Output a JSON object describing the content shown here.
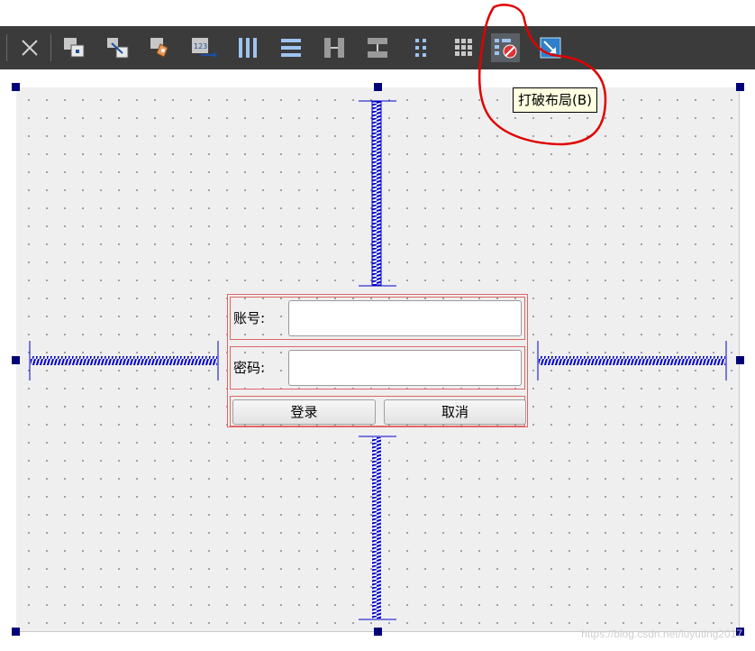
{
  "toolbar": {
    "buttons": [
      {
        "name": "close-icon"
      },
      {
        "name": "edit-widgets-icon"
      },
      {
        "name": "edit-signals-slots-icon"
      },
      {
        "name": "edit-buddies-icon"
      },
      {
        "name": "edit-tab-order-icon"
      },
      {
        "name": "layout-horizontal-icon"
      },
      {
        "name": "layout-vertical-icon"
      },
      {
        "name": "layout-horizontal-splitter-icon"
      },
      {
        "name": "layout-vertical-splitter-icon"
      },
      {
        "name": "layout-form-icon"
      },
      {
        "name": "layout-grid-icon"
      },
      {
        "name": "break-layout-icon"
      },
      {
        "name": "adjust-size-icon"
      }
    ],
    "tooltip": "打破布局(B)"
  },
  "form": {
    "account_label": "账号:",
    "password_label": "密码:",
    "account_value": "",
    "password_value": "",
    "login_button": "登录",
    "cancel_button": "取消"
  },
  "colors": {
    "toolbar_bg": "#3b3b3b",
    "canvas_bg": "#efefef",
    "layout_border": "#e06666",
    "spacer": "#0000cc",
    "handle": "#00007a",
    "annotation": "#e00000"
  },
  "watermark": "https://blog.csdn.net/luyuting2017"
}
